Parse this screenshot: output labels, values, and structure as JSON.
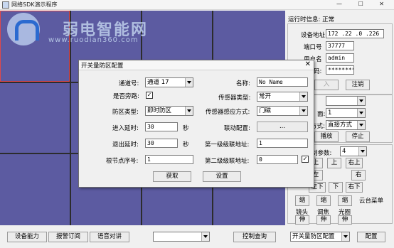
{
  "window": {
    "title": "网络SDK演示程序",
    "controls": "—  ☐  ✕"
  },
  "watermark": {
    "text": "弱电智能网",
    "url": "www.ruodian360.com"
  },
  "right_panel": {
    "status_label": "运行时信息: 正常",
    "device_address_label": "设备地址",
    "device_address_value": "172 .22 .0 .226",
    "port_label": "端口号",
    "port_value": "37777",
    "username_label": "用户名",
    "username_value": "admin",
    "password_label": "码:",
    "password_value": "********",
    "login_button": "入",
    "logout_button": "注销",
    "screen_label": "面:",
    "screen_value": "1",
    "mode_label": "方式:",
    "mode_value": "直接方式",
    "play_button": "播放",
    "stop_button": "停止",
    "ptz_param_label": "制参数:",
    "ptz_param_value": "4",
    "ptz_buttons": [
      "上",
      "上",
      "右上",
      "左",
      "右",
      "左下",
      "下",
      "右下"
    ],
    "zoom_in_label": "缩",
    "focus_in_label": "缩",
    "iris_in_label": "缩",
    "ptz_menu_label": "云台菜单",
    "zoom_label": "镜头",
    "focus_label": "调焦",
    "iris_label": "光圈",
    "zoom_out_label": "伸",
    "focus_out_label": "伸",
    "iris_out_label": "伸"
  },
  "bottom_bar": {
    "capability_button": "设备能力",
    "alarm_subscribe_button": "报警订阅",
    "voice_talk_button": "语音对讲",
    "combo_value": "",
    "control_query_button": "控制查询",
    "config_select_value": "开关量防区配置",
    "config_button": "配置"
  },
  "dialog": {
    "title": "开关量防区配置",
    "close": "✕",
    "channel_label": "通道号:",
    "channel_value": "通道 17",
    "name_label": "名称:",
    "name_value": "No Name",
    "bypass_label": "是否旁路:",
    "bypass_checked": "✓",
    "sensor_type_label": "传感器类型:",
    "sensor_type_value": "常开",
    "zone_type_label": "防区类型:",
    "zone_type_value": "即时防区",
    "sensor_mode_label": "传感器感应方式:",
    "sensor_mode_value": "门磁",
    "entry_delay_label": "进入延时:",
    "entry_delay_value": "30",
    "entry_delay_unit": "秒",
    "link_config_label": "联动配置:",
    "link_config_button": "...",
    "exit_delay_label": "退出延时:",
    "exit_delay_value": "30",
    "exit_delay_unit": "秒",
    "first_link_label": "第一级级联地址:",
    "first_link_value": "1",
    "root_node_label": "根节点序号:",
    "root_node_value": "1",
    "second_link_label": "第二级级联地址:",
    "second_link_value": "0",
    "second_link_checked": "✓",
    "get_button": "获取",
    "set_button": "设置"
  },
  "colors": {
    "video_pane": "#5c5ba1",
    "selected_border": "#e0484b",
    "background": "#f0f0f0"
  }
}
